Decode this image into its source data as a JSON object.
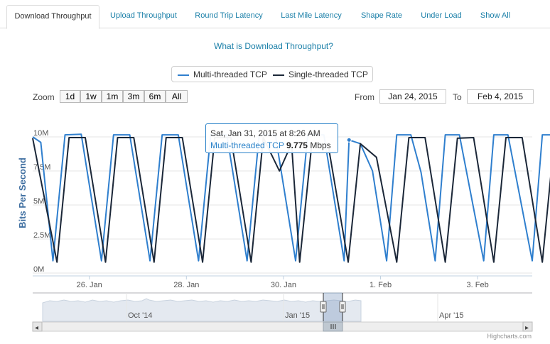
{
  "tabs": [
    {
      "label": "Download Throughput",
      "active": true
    },
    {
      "label": "Upload Throughput",
      "active": false
    },
    {
      "label": "Round Trip Latency",
      "active": false
    },
    {
      "label": "Last Mile Latency",
      "active": false
    },
    {
      "label": "Shape Rate",
      "active": false
    },
    {
      "label": "Under Load",
      "active": false
    },
    {
      "label": "Show All",
      "active": false
    }
  ],
  "info_link": "What is Download Throughput?",
  "legend": [
    {
      "label": "Multi-threaded TCP",
      "color": "#2f7fce"
    },
    {
      "label": "Single-threaded TCP",
      "color": "#1b2738"
    }
  ],
  "range_selector": {
    "zoom_label": "Zoom",
    "buttons": [
      "1d",
      "1w",
      "1m",
      "3m",
      "6m",
      "All"
    ],
    "from_label": "From",
    "from_value": "Jan 24, 2015",
    "to_label": "To",
    "to_value": "Feb 4, 2015"
  },
  "tooltip": {
    "date": "Sat, Jan 31, 2015 at 8:26 AM",
    "series": "Multi-threaded TCP",
    "value": "9.775",
    "unit": "Mbps"
  },
  "navigator": {
    "labels": [
      "Oct '14",
      "Jan '15",
      "Apr '15"
    ],
    "left_arrow": "◂",
    "right_arrow": "▸"
  },
  "credits": "Highcharts.com",
  "chart_data": {
    "type": "line",
    "ylabel": "Bits Per Second",
    "ylim": [
      0,
      10000000
    ],
    "y_ticks": [
      "0M",
      "2.5M",
      "5M",
      "7.5M",
      "10M"
    ],
    "x_ticks": [
      "26. Jan",
      "28. Jan",
      "30. Jan",
      "1. Feb",
      "3. Feb"
    ],
    "xlim": [
      "2015-01-24 20:00",
      "2015-02-04 03:00"
    ],
    "series": [
      {
        "name": "Multi-threaded TCP",
        "color": "#2f7fce",
        "points": [
          [
            "2015-01-24 20:00",
            10000000
          ],
          [
            "2015-01-25 00:00",
            9600000
          ],
          [
            "2015-01-25 06:00",
            900000
          ],
          [
            "2015-01-25 12:00",
            10150000
          ],
          [
            "2015-01-25 20:00",
            10200000
          ],
          [
            "2015-01-26 06:00",
            900000
          ],
          [
            "2015-01-26 12:00",
            10150000
          ],
          [
            "2015-01-26 20:00",
            10150000
          ],
          [
            "2015-01-27 06:00",
            900000
          ],
          [
            "2015-01-27 12:00",
            10150000
          ],
          [
            "2015-01-27 20:00",
            10150000
          ],
          [
            "2015-01-28 06:00",
            900000
          ],
          [
            "2015-01-28 12:00",
            10150000
          ],
          [
            "2015-01-28 20:00",
            10150000
          ],
          [
            "2015-01-29 06:00",
            900000
          ],
          [
            "2015-01-29 12:00",
            10150000
          ],
          [
            "2015-01-29 20:00",
            10150000
          ],
          [
            "2015-01-30 06:00",
            900000
          ],
          [
            "2015-01-30 12:00",
            10150000
          ],
          [
            "2015-01-30 20:00",
            10150000
          ],
          [
            "2015-01-31 06:00",
            900000
          ],
          [
            "2015-01-31 08:26",
            9775000
          ],
          [
            "2015-01-31 14:00",
            9500000
          ],
          [
            "2015-01-31 20:00",
            7500000
          ],
          [
            "2015-02-01 03:00",
            900000
          ],
          [
            "2015-02-01 08:00",
            10150000
          ],
          [
            "2015-02-01 15:00",
            10150000
          ],
          [
            "2015-02-01 20:00",
            7400000
          ],
          [
            "2015-02-02 03:00",
            900000
          ],
          [
            "2015-02-02 08:00",
            10150000
          ],
          [
            "2015-02-02 15:00",
            10150000
          ],
          [
            "2015-02-03 03:00",
            900000
          ],
          [
            "2015-02-03 08:00",
            10150000
          ],
          [
            "2015-02-03 15:00",
            10150000
          ],
          [
            "2015-02-04 03:00",
            900000
          ],
          [
            "2015-02-04 08:00",
            10150000
          ],
          [
            "2015-02-04 15:00",
            10150000
          ]
        ]
      },
      {
        "name": "Single-threaded TCP",
        "color": "#1b2738",
        "points": [
          [
            "2015-01-24 20:00",
            9900000
          ],
          [
            "2015-01-25 08:00",
            800000
          ],
          [
            "2015-01-25 14:00",
            9950000
          ],
          [
            "2015-01-25 22:00",
            9950000
          ],
          [
            "2015-01-26 08:00",
            800000
          ],
          [
            "2015-01-26 14:00",
            9950000
          ],
          [
            "2015-01-26 22:00",
            9950000
          ],
          [
            "2015-01-27 08:00",
            800000
          ],
          [
            "2015-01-27 14:00",
            9950000
          ],
          [
            "2015-01-27 22:00",
            9950000
          ],
          [
            "2015-01-28 08:00",
            800000
          ],
          [
            "2015-01-28 14:00",
            9950000
          ],
          [
            "2015-01-28 22:00",
            9950000
          ],
          [
            "2015-01-29 08:00",
            800000
          ],
          [
            "2015-01-29 14:00",
            9950000
          ],
          [
            "2015-01-29 22:00",
            7500000
          ],
          [
            "2015-01-30 04:00",
            9500000
          ],
          [
            "2015-01-30 08:00",
            800000
          ],
          [
            "2015-01-30 14:00",
            9500000
          ],
          [
            "2015-01-30 22:00",
            9500000
          ],
          [
            "2015-01-31 08:00",
            800000
          ],
          [
            "2015-01-31 14:00",
            9500000
          ],
          [
            "2015-01-31 22:00",
            8500000
          ],
          [
            "2015-02-01 08:00",
            800000
          ],
          [
            "2015-02-01 14:00",
            9950000
          ],
          [
            "2015-02-01 22:00",
            9950000
          ],
          [
            "2015-02-02 08:00",
            800000
          ],
          [
            "2015-02-02 14:00",
            9900000
          ],
          [
            "2015-02-02 22:00",
            9950000
          ],
          [
            "2015-02-03 08:00",
            800000
          ],
          [
            "2015-02-03 14:00",
            9950000
          ],
          [
            "2015-02-03 22:00",
            9950000
          ],
          [
            "2015-02-04 08:00",
            800000
          ],
          [
            "2015-02-04 14:00",
            9900000
          ]
        ]
      }
    ]
  }
}
